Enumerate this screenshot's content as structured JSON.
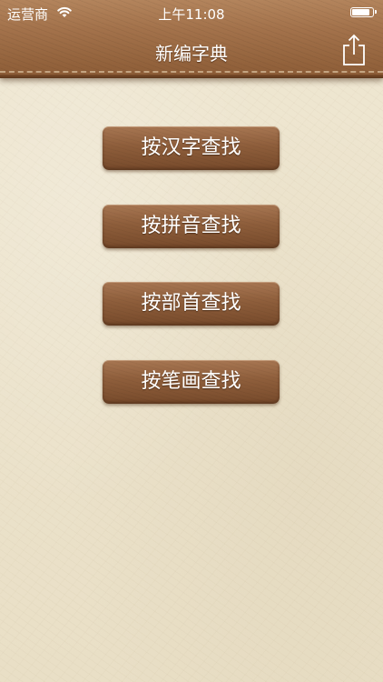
{
  "status_bar": {
    "carrier": "运营商",
    "time": "上午11:08",
    "wifi_icon": "wifi-icon",
    "battery_icon": "battery-icon"
  },
  "nav": {
    "title": "新编字典",
    "share_icon": "share-icon"
  },
  "buttons": [
    {
      "label": "按汉字查找"
    },
    {
      "label": "按拼音查找"
    },
    {
      "label": "按部首查找"
    },
    {
      "label": "按笔画查找"
    }
  ],
  "colors": {
    "header_brown": "#a2714a",
    "button_brown": "#8e5e3b",
    "background_parchment": "#ebe2cc",
    "text_white": "#ffffff"
  }
}
